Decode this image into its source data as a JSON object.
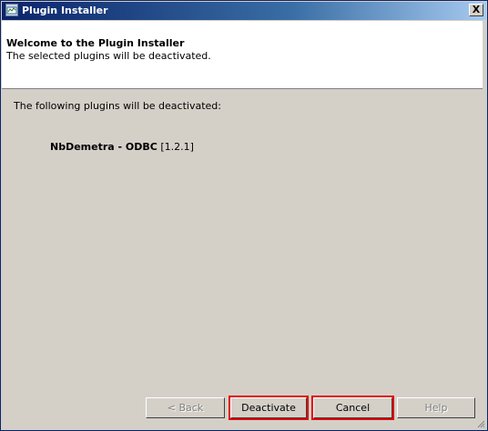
{
  "window": {
    "title": "Plugin Installer",
    "close_glyph": "X"
  },
  "header": {
    "title": "Welcome to the Plugin Installer",
    "subtitle": "The selected plugins will be deactivated."
  },
  "body": {
    "intro": "The following plugins will be deactivated:",
    "plugins": [
      {
        "name": "NbDemetra - ODBC",
        "version": "[1.2.1]"
      }
    ]
  },
  "buttons": {
    "back": "< Back",
    "deactivate": "Deactivate",
    "cancel": "Cancel",
    "help": "Help"
  },
  "colors": {
    "titlebar_start": "#0a246a",
    "titlebar_end": "#a6caf0",
    "highlight": "#e00000",
    "background": "#d4d0c8"
  }
}
